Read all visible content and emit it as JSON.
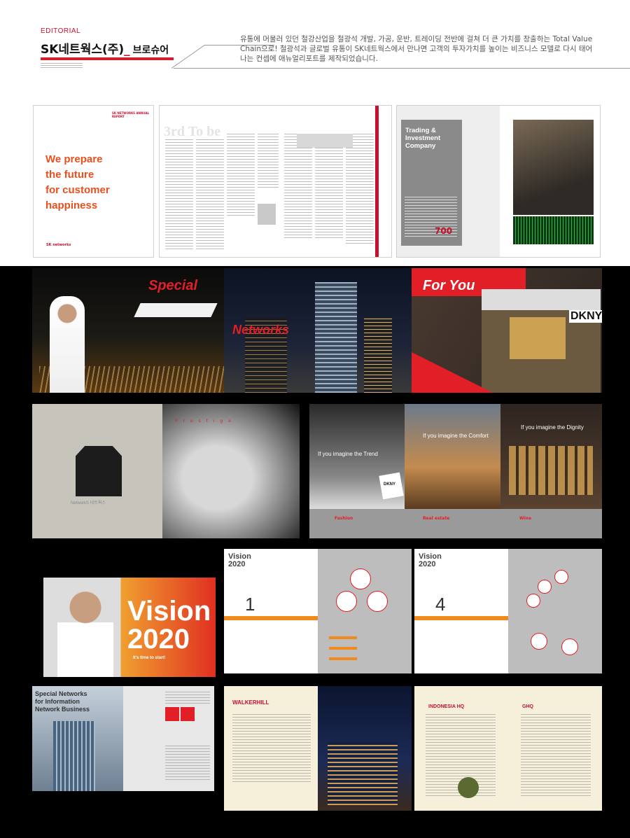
{
  "header": {
    "category": "EDITORIAL",
    "title_company": "SK네트웍스(주)",
    "title_underscore": "_",
    "title_type": "브로슈어",
    "description": "유통에 머물러 있던 철강산업을 철광석 개발, 가공, 운반, 트레이딩 전반에 걸쳐 더 큰 가치를 창출하는 Total Value Chain으로! 철광석과 글로벌 유통이 SK네트웍스에서 만나면 고객의 투자가치를 높이는 비즈니스 모델로 다시 태어나는 컨셉에 애뉴얼리포트를 제작되었습니다."
  },
  "thumbnails": {
    "cover_text": "We prepare\nthe future\nfor customer\nhappiness",
    "cover_logo": "SK networks",
    "spread2_watermark": "3rd To be",
    "spread3_title": "Trading &\nInvestment\nCompany",
    "spread3_stat": "700"
  },
  "gallery": {
    "row1": {
      "special": "Special",
      "networks": "Networks",
      "for_you": "For You",
      "dkny": "DKNY"
    },
    "row2": {
      "brand": "NetworkS 네트웍스",
      "prestige_line": "P r e s t i g e",
      "trend": "If you imagine the Trend",
      "comfort": "If you imagine the Comfort",
      "dignity": "If you imagine the Dignity",
      "fashion": "Fashion",
      "real_estate": "Real estate",
      "wine": "Wine",
      "bag_logo": "DKNY"
    },
    "row3": {
      "vision_word": "Vision",
      "vision_year": "2020",
      "page_head": "Vision\n2020",
      "tagline": "It's time to start!",
      "num1": "1",
      "num4": "4"
    },
    "row4": {
      "cover_title": "Special Networks\nfor Information\nNetwork Business",
      "walkerhill": "WALKERHILL",
      "indonesia": "INDONESIA HQ",
      "ghq": "GHQ"
    }
  }
}
